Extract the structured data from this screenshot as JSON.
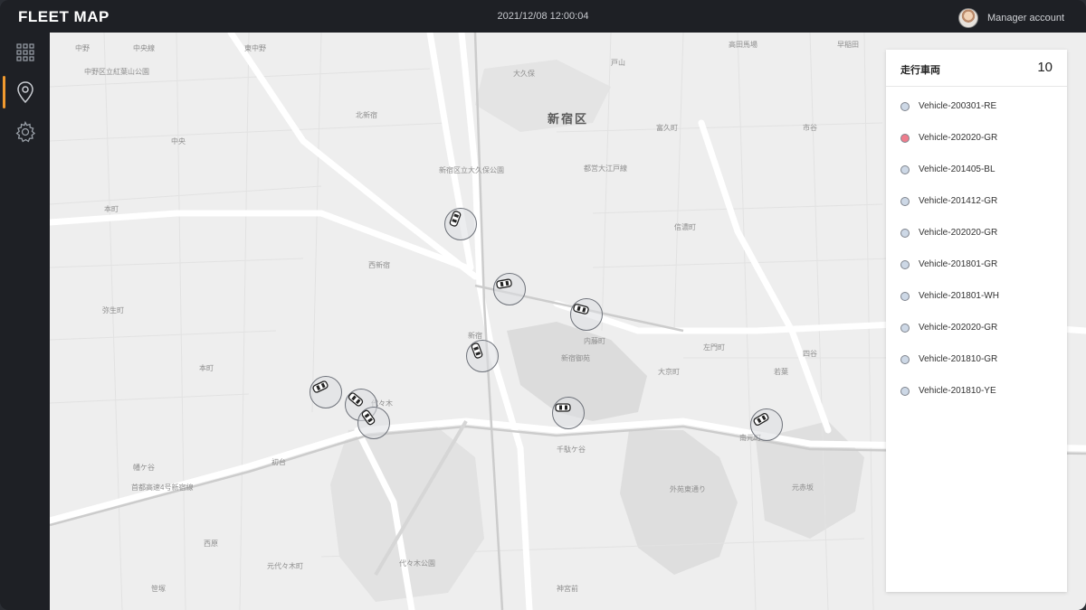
{
  "app": {
    "title": "FLEET MAP",
    "datetime": "2021/12/08 12:00:04",
    "account_label": "Manager account"
  },
  "sidebar": {
    "items": [
      {
        "icon": "grid-icon",
        "active": false
      },
      {
        "icon": "map-pin-icon",
        "active": true
      },
      {
        "icon": "gear-icon",
        "active": false
      }
    ]
  },
  "map": {
    "district_label": "新宿区",
    "labels": [
      "中野",
      "中央線",
      "高田馬場",
      "東中野",
      "中野区立紅葉山公園",
      "大久保",
      "戸山",
      "早稲田",
      "西新宿",
      "新宿",
      "代々木",
      "千駄ケ谷",
      "初台",
      "幡ケ谷",
      "本町",
      "弥生町",
      "南元町",
      "四谷",
      "元赤坂",
      "代々木公園",
      "神宮前",
      "北新宿",
      "富久町",
      "市谷",
      "信濃町",
      "外苑東通り",
      "新宿御苑",
      "都営大江戸線",
      "首都高速4号新宿線",
      "笹塚",
      "内藤町",
      "大京町",
      "左門町",
      "若葉",
      "元代々木町",
      "西原",
      "本町",
      "中央",
      "新宿区立大久保公園"
    ]
  },
  "panel": {
    "title": "走行車両",
    "count": "10",
    "vehicles": [
      {
        "name": "Vehicle-200301-RE",
        "status_color": "#cdd8e6"
      },
      {
        "name": "Vehicle-202020-GR",
        "status_color": "#ef7d8d"
      },
      {
        "name": "Vehicle-201405-BL",
        "status_color": "#cdd8e6"
      },
      {
        "name": "Vehicle-201412-GR",
        "status_color": "#cdd8e6"
      },
      {
        "name": "Vehicle-202020-GR",
        "status_color": "#cdd8e6"
      },
      {
        "name": "Vehicle-201801-GR",
        "status_color": "#cdd8e6"
      },
      {
        "name": "Vehicle-201801-WH",
        "status_color": "#cdd8e6"
      },
      {
        "name": "Vehicle-202020-GR",
        "status_color": "#cdd8e6"
      },
      {
        "name": "Vehicle-201810-GR",
        "status_color": "#cdd8e6"
      },
      {
        "name": "Vehicle-201810-YE",
        "status_color": "#cdd8e6"
      }
    ]
  },
  "colors": {
    "accent": "#f19a2f",
    "topbar": "#1e2025",
    "map_bg": "#eeeeee",
    "alert_dot": "#ef7d8d"
  }
}
